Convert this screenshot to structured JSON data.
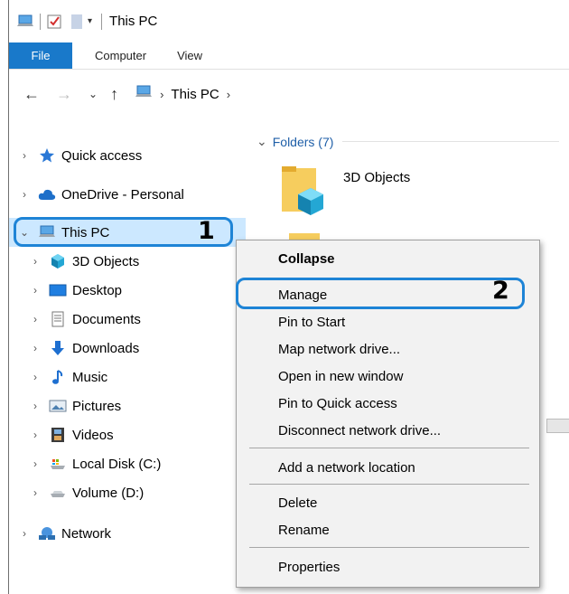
{
  "window": {
    "title": "This PC"
  },
  "ribbon": {
    "tabs": [
      "File",
      "Computer",
      "View"
    ]
  },
  "address": {
    "location": "This PC"
  },
  "sidebar": {
    "items": [
      {
        "label": "Quick access",
        "icon": "star-icon"
      },
      {
        "label": "OneDrive - Personal",
        "icon": "cloud-icon"
      },
      {
        "label": "This PC",
        "icon": "computer-icon"
      },
      {
        "label": "3D Objects",
        "icon": "cube-icon"
      },
      {
        "label": "Desktop",
        "icon": "desktop-icon"
      },
      {
        "label": "Documents",
        "icon": "document-icon"
      },
      {
        "label": "Downloads",
        "icon": "download-icon"
      },
      {
        "label": "Music",
        "icon": "music-icon"
      },
      {
        "label": "Pictures",
        "icon": "picture-icon"
      },
      {
        "label": "Videos",
        "icon": "video-icon"
      },
      {
        "label": "Local Disk (C:)",
        "icon": "drive-icon"
      },
      {
        "label": "Volume (D:)",
        "icon": "drive-icon"
      },
      {
        "label": "Network",
        "icon": "network-icon"
      }
    ]
  },
  "content": {
    "folders_header": "Folders (7)",
    "folders": [
      {
        "label": "3D Objects"
      }
    ]
  },
  "context_menu": {
    "items": [
      "Collapse",
      "Manage",
      "Pin to Start",
      "Map network drive...",
      "Open in new window",
      "Pin to Quick access",
      "Disconnect network drive...",
      "Add a network location",
      "Delete",
      "Rename",
      "Properties"
    ]
  },
  "callouts": {
    "step1": "1",
    "step2": "2"
  },
  "colors": {
    "accent": "#1979ca",
    "selection": "#cce8ff",
    "callout": "#1e84d6"
  }
}
